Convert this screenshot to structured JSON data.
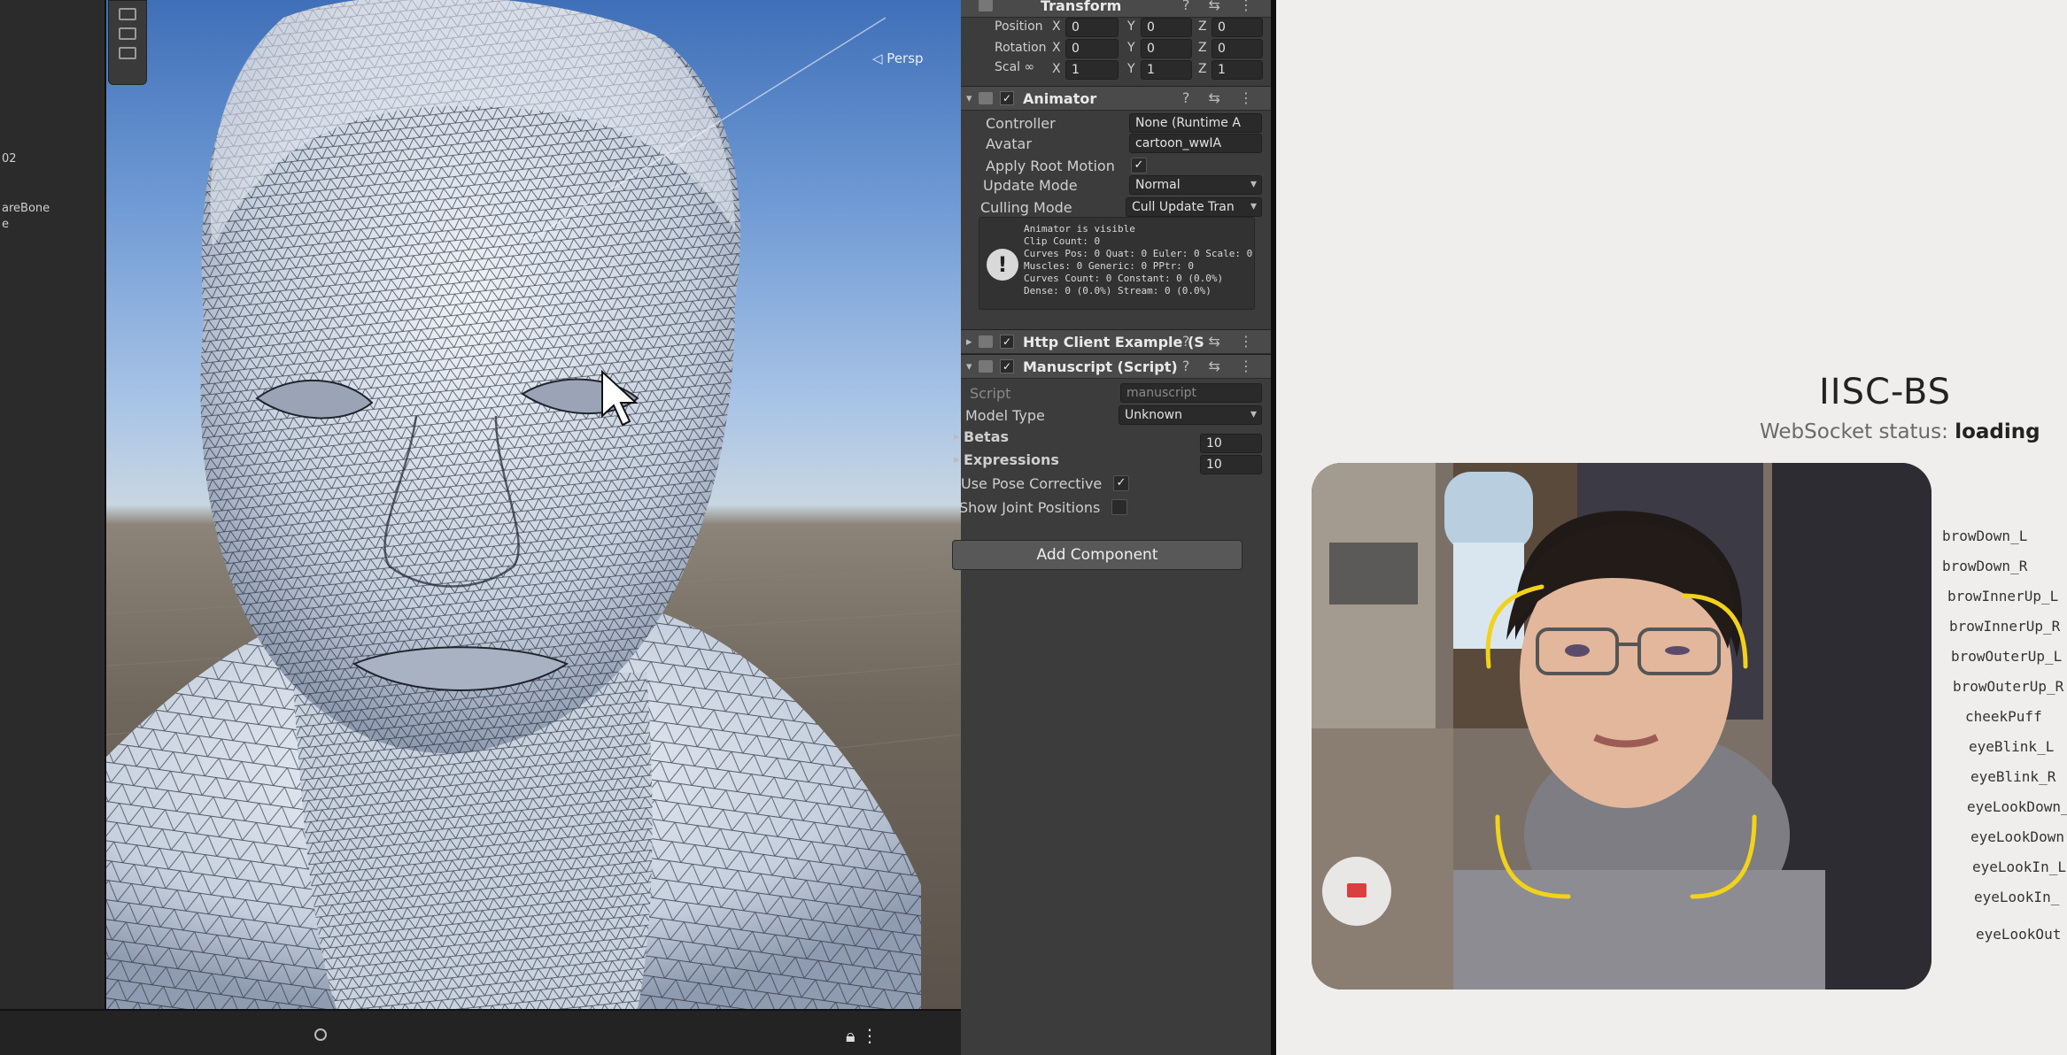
{
  "hierarchy": {
    "items": [
      "02",
      "areBone",
      "e"
    ]
  },
  "scene": {
    "view_label": "◁ Persp",
    "mesh_fill": "#d6dde8",
    "mesh_line": "#2a2f3a",
    "sky_top": "#3f6fb8",
    "ground": "#6f665c"
  },
  "inspector": {
    "transform": {
      "title": "Transform",
      "rows": [
        {
          "label": "Position",
          "x": "0",
          "y": "0",
          "z": "0"
        },
        {
          "label": "Rotation",
          "x": "0",
          "y": "0",
          "z": "0"
        },
        {
          "label": "Scal ∞",
          "x": "1",
          "y": "1",
          "z": "1"
        }
      ]
    },
    "animator": {
      "title": "Animator",
      "controller_label": "Controller",
      "controller_value": "None (Runtime A",
      "avatar_label": "Avatar",
      "avatar_value": "cartoon_wwIA",
      "apply_root_motion_label": "Apply Root Motion",
      "update_mode_label": "Update Mode",
      "update_mode_value": "Normal",
      "culling_mode_label": "Culling Mode",
      "culling_mode_value": "Cull Update Tran",
      "info": "Animator is visible\nClip Count: 0\nCurves Pos: 0 Quat: 0 Euler: 0 Scale: 0\nMuscles: 0 Generic: 0 PPtr: 0\nCurves Count: 0 Constant: 0 (0.0%)\nDense: 0 (0.0%) Stream: 0 (0.0%)"
    },
    "http_client": {
      "title": "Http Client Example (S"
    },
    "manuscript": {
      "title": "Manuscript (Script)",
      "script_label": "Script",
      "script_value": "manuscript",
      "model_type_label": "Model Type",
      "model_type_value": "Unknown",
      "betas_label": "Betas",
      "betas_value": "10",
      "expressions_label": "Expressions",
      "expressions_value": "10",
      "use_pose_label": "Use Pose Corrective",
      "show_joint_label": "Show Joint Positions"
    },
    "add_component": "Add Component"
  },
  "web": {
    "title": "IISC-BS",
    "ws_prefix": "WebSocket status:",
    "ws_status": "loading",
    "corner_color": "#f2d21b",
    "blendshapes": [
      "browDown_L",
      "browDown_R",
      "browInnerUp_L",
      "browInnerUp_R",
      "browOuterUp_L",
      "browOuterUp_R",
      "cheekPuff",
      "eyeBlink_L",
      "eyeBlink_R",
      "eyeLookDown_",
      "eyeLookDown",
      "eyeLookIn_L",
      "eyeLookIn_",
      "eyeLookOut"
    ]
  }
}
